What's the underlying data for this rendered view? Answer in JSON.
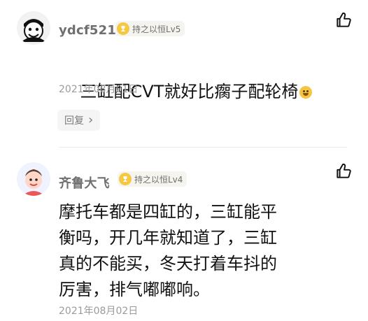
{
  "comments": [
    {
      "username": "ydcf521",
      "badge": "持之以恒Lv5",
      "content": "三缸配CVT就好比瘸子配轮椅",
      "emoji": "grin-emoji",
      "date": "2021年08月01日",
      "reply_label": "回复",
      "reply_chevron": "›"
    },
    {
      "username": "齐鲁大飞",
      "badge": "持之以恒Lv4",
      "content": "摩托车都是四缸的，三缸能平\n衡吗，开几年就知道了，三缸\n真的不能买，冬天打着车抖的\n厉害，排气嘟嘟响。",
      "date": "2021年08月02日"
    }
  ],
  "icons": {
    "like": "thumbs-up-icon",
    "badge": "trophy-icon"
  },
  "colors": {
    "badge_bg": "#f6f4ef",
    "trophy": "#f5c842",
    "text_muted": "#9b9b9b"
  }
}
